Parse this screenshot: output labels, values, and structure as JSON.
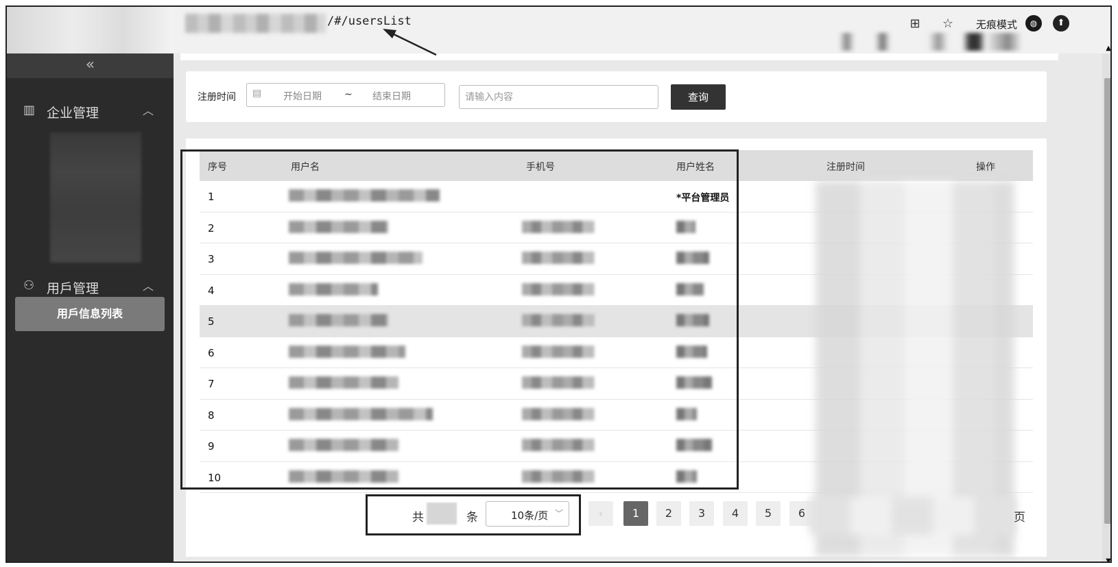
{
  "browser": {
    "url_path": "/#/usersList",
    "incognito_label": "无痕模式",
    "icons": [
      "translate-icon",
      "star-icon",
      "incognito-icon",
      "profile-icon"
    ]
  },
  "sidebar": {
    "collapse_icon": "«",
    "groups": [
      {
        "label": "企业管理",
        "icon": "building-icon",
        "expanded": true
      },
      {
        "label": "用戶管理",
        "icon": "user-settings-icon",
        "expanded": true
      }
    ],
    "active_item": "用戶信息列表"
  },
  "filter": {
    "label": "注册时间",
    "start_placeholder": "开始日期",
    "separator": "~",
    "end_placeholder": "结束日期",
    "keyword_placeholder": "请输入内容",
    "query_label": "查询"
  },
  "table": {
    "columns": [
      "序号",
      "用户名",
      "手机号",
      "用户姓名",
      "注册时间",
      "操作"
    ],
    "rows": [
      {
        "index": "1",
        "real_name": "*平台管理员"
      },
      {
        "index": "2"
      },
      {
        "index": "3"
      },
      {
        "index": "4"
      },
      {
        "index": "5"
      },
      {
        "index": "6"
      },
      {
        "index": "7"
      },
      {
        "index": "8"
      },
      {
        "index": "9"
      },
      {
        "index": "10"
      }
    ]
  },
  "pagination": {
    "total_prefix": "共",
    "total_suffix": "条",
    "page_size": "10条/页",
    "pages": [
      "1",
      "2",
      "3",
      "4",
      "5",
      "6"
    ],
    "current_page": "1",
    "trailing": "页"
  }
}
